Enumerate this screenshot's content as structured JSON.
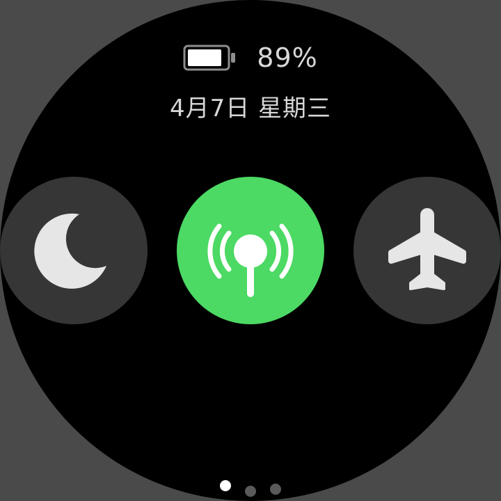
{
  "status": {
    "battery_percent": "89%",
    "battery_level": 0.89,
    "date": "4月7日 星期三"
  },
  "toggles": [
    {
      "name": "do-not-disturb",
      "icon": "moon-icon",
      "active": false,
      "color": "#363636"
    },
    {
      "name": "cellular-signal",
      "icon": "antenna-icon",
      "active": true,
      "color": "#4cd964"
    },
    {
      "name": "airplane-mode",
      "icon": "airplane-icon",
      "active": false,
      "color": "#363636"
    }
  ],
  "pagination": {
    "count": 3,
    "current": 1
  },
  "colors": {
    "accent": "#4cd964",
    "inactive_toggle": "#363636",
    "text": "#d8d8d8"
  }
}
